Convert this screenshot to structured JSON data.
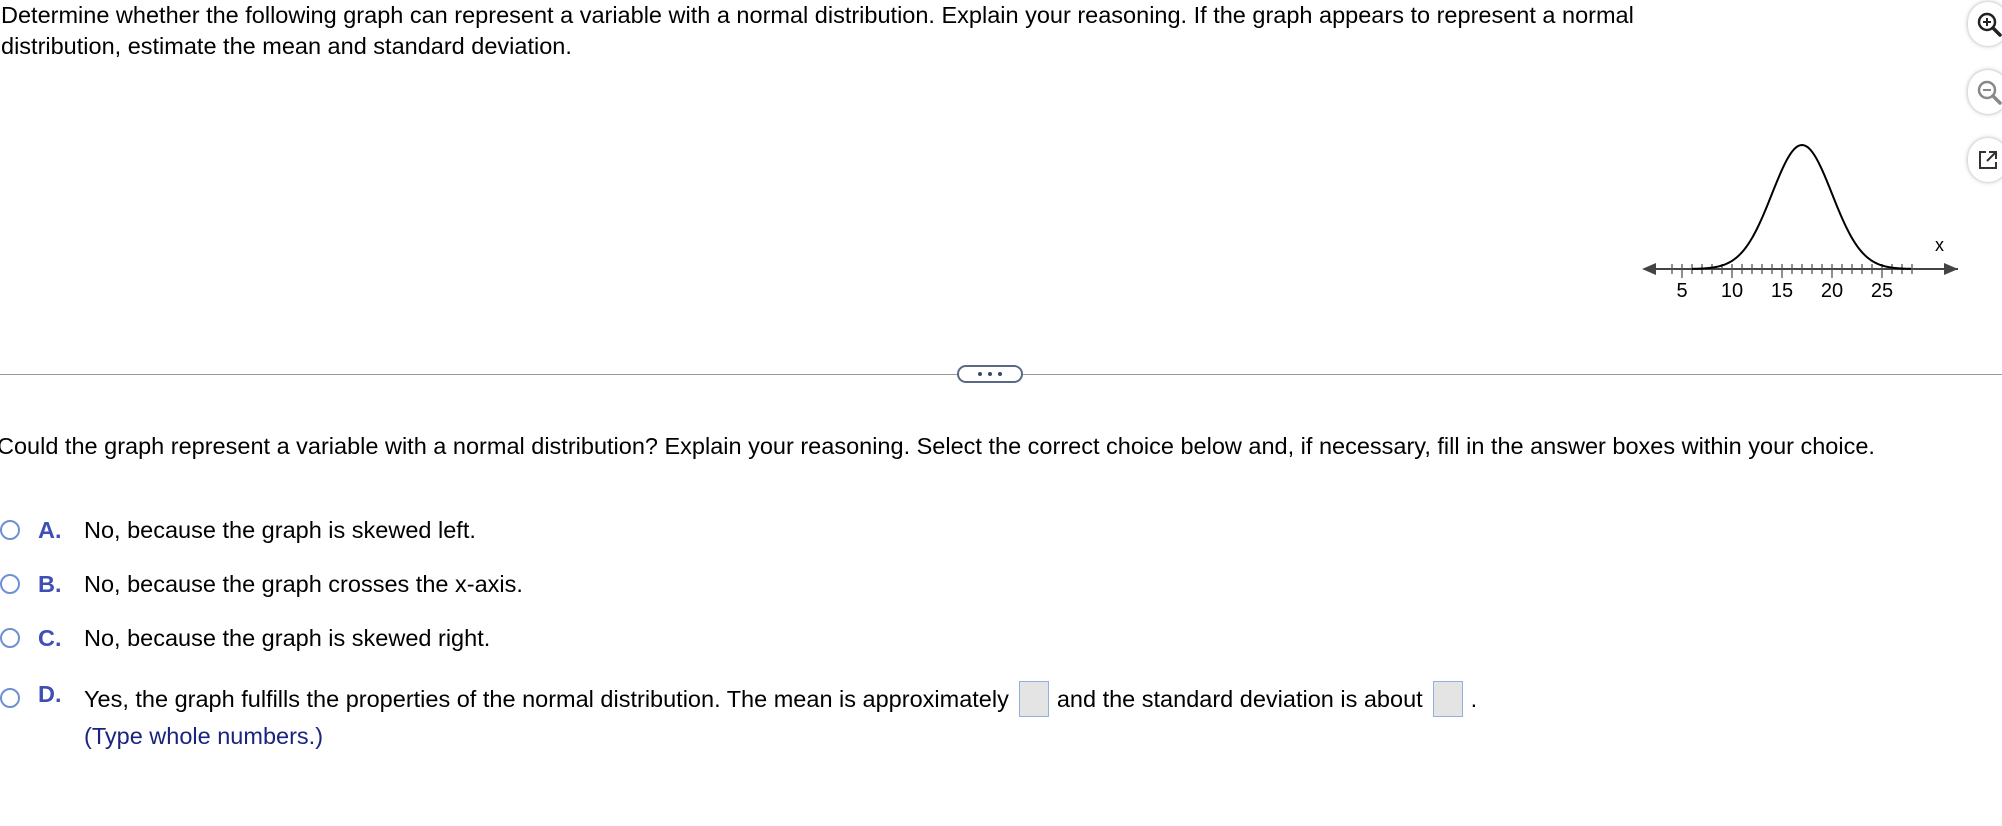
{
  "question": {
    "text": "Determine whether the following graph can represent a variable with a normal distribution. Explain your reasoning. If the graph appears to represent a normal distribution, estimate the mean and standard deviation."
  },
  "graph": {
    "axis_label": "x",
    "tick_labels": [
      "5",
      "10",
      "15",
      "20",
      "25"
    ]
  },
  "tools": {
    "zoom_in": "zoom-in-icon",
    "zoom_out": "zoom-out-icon",
    "popout": "popout-icon"
  },
  "prompt": {
    "text": "Could the graph represent a variable with a normal distribution? Explain your reasoning. Select the correct choice below and, if necessary, fill in the answer boxes within your choice."
  },
  "choices": [
    {
      "letter": "A.",
      "text": "No, because the graph is skewed left."
    },
    {
      "letter": "B.",
      "text": "No, because the graph crosses the x-axis."
    },
    {
      "letter": "C.",
      "text": "No, because the graph is skewed right."
    },
    {
      "letter": "D.",
      "text_before": "Yes, the graph fulfills the properties of the normal distribution. The mean is approximately",
      "text_middle": "and the standard deviation is about",
      "text_after": ".",
      "mean_value": "",
      "sd_value": "",
      "hint": "(Type whole numbers.)"
    }
  ],
  "colors": {
    "letter": "#3f4fb3",
    "radio": "#6f8fd6",
    "hint": "#1a237e"
  }
}
